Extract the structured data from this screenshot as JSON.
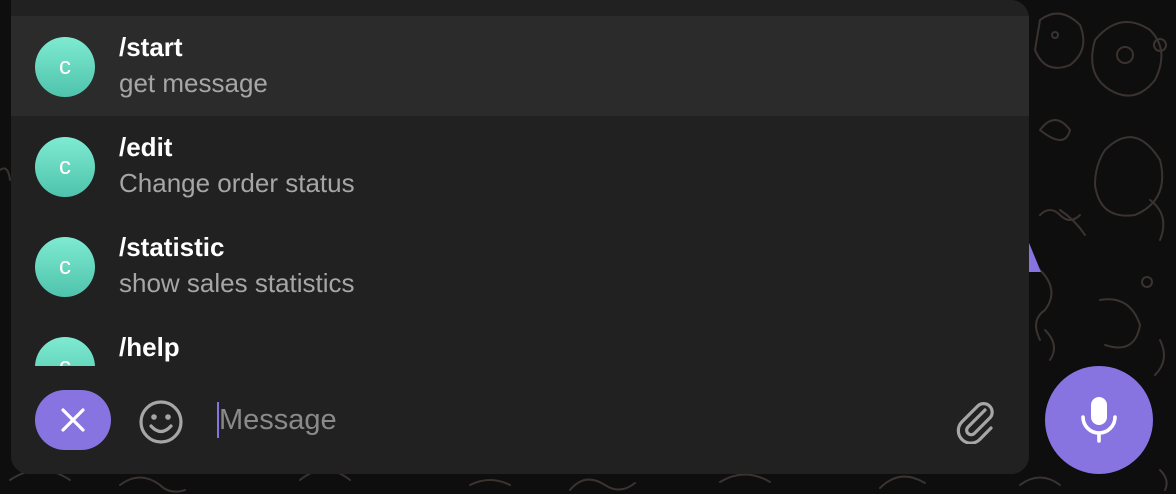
{
  "colors": {
    "accent": "#8774e1",
    "panel": "#212121",
    "highlight": "#2b2b2b",
    "avatar_top": "#7eebd1",
    "avatar_bottom": "#4fc3ac",
    "wallpaper": "#0e0e0e"
  },
  "commands": [
    {
      "avatar_letter": "c",
      "name": "/start",
      "description": "get message",
      "highlighted": true
    },
    {
      "avatar_letter": "c",
      "name": "/edit",
      "description": "Change order status",
      "highlighted": false
    },
    {
      "avatar_letter": "c",
      "name": "/statistic",
      "description": "show sales statistics",
      "highlighted": false
    },
    {
      "avatar_letter": "c",
      "name": "/help",
      "description": "",
      "highlighted": false
    }
  ],
  "composer": {
    "placeholder": "Message",
    "value": "",
    "close_icon": "close-icon",
    "emoji_icon": "smile-icon",
    "attach_icon": "paperclip-icon",
    "mic_icon": "microphone-icon"
  }
}
